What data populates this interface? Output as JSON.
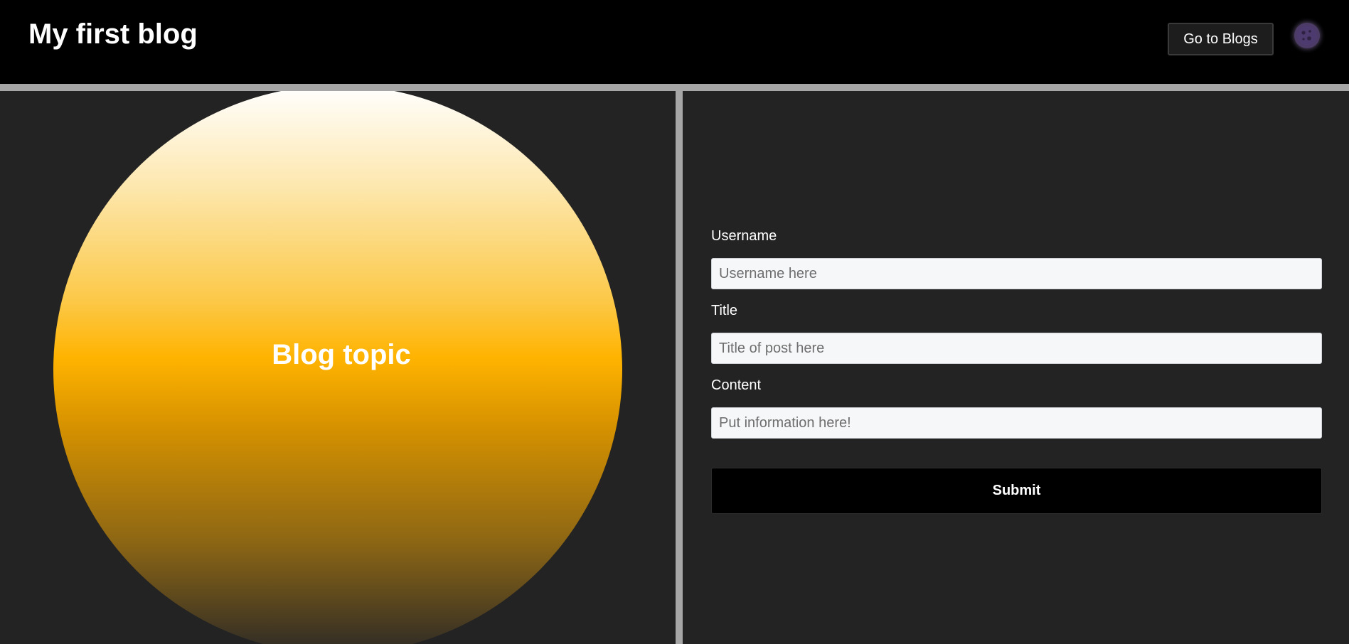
{
  "header": {
    "title": "My first blog",
    "nav_button_label": "Go to Blogs",
    "theme_toggle_icon": "moon-icon"
  },
  "hero": {
    "topic_label": "Blog topic",
    "gradient_colors": [
      "#ffffff",
      "#ffb300",
      "#2d2a26"
    ]
  },
  "form": {
    "username": {
      "label": "Username",
      "placeholder": "Username here",
      "value": ""
    },
    "title": {
      "label": "Title",
      "placeholder": "Title of post here",
      "value": ""
    },
    "content": {
      "label": "Content",
      "placeholder": "Put information here!",
      "value": ""
    },
    "submit_label": "Submit"
  },
  "colors": {
    "header_bg": "#000000",
    "page_bg": "#232323",
    "divider": "#a6a6a6",
    "accent": "#ffb300"
  }
}
